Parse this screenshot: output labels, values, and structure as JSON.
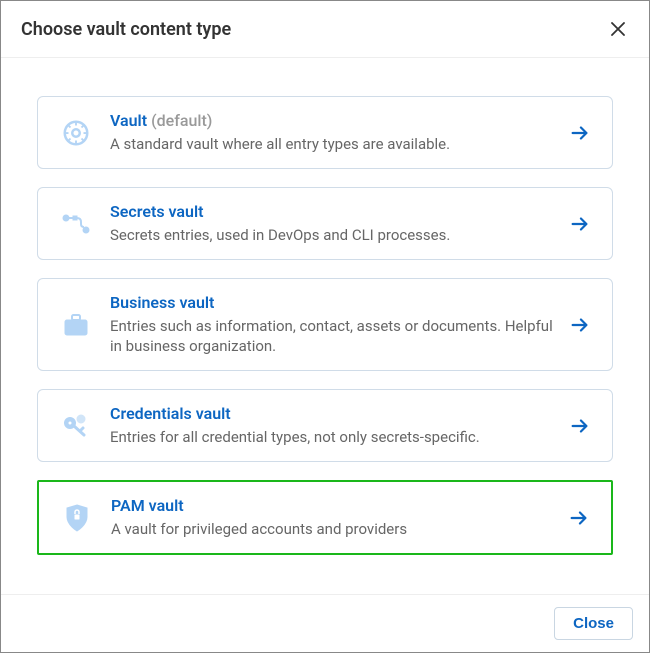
{
  "dialog": {
    "title": "Choose vault content type",
    "closeButton": "Close"
  },
  "options": [
    {
      "key": "vault",
      "title": "Vault",
      "suffix": "(default)",
      "description": "A standard vault where all entry types are available.",
      "icon": "gear-outline-icon",
      "highlighted": false
    },
    {
      "key": "secrets",
      "title": "Secrets vault",
      "suffix": "",
      "description": "Secrets entries, used in DevOps and CLI processes.",
      "icon": "pipeline-icon",
      "highlighted": false
    },
    {
      "key": "business",
      "title": "Business vault",
      "suffix": "",
      "description": "Entries such as information, contact, assets or documents. Helpful in business organization.",
      "icon": "briefcase-icon",
      "highlighted": false
    },
    {
      "key": "credentials",
      "title": "Credentials vault",
      "suffix": "",
      "description": "Entries for all credential types, not only secrets-specific.",
      "icon": "key-icon",
      "highlighted": false
    },
    {
      "key": "pam",
      "title": "PAM vault",
      "suffix": "",
      "description": "A vault for privileged accounts and providers",
      "icon": "shield-lock-icon",
      "highlighted": true
    }
  ]
}
